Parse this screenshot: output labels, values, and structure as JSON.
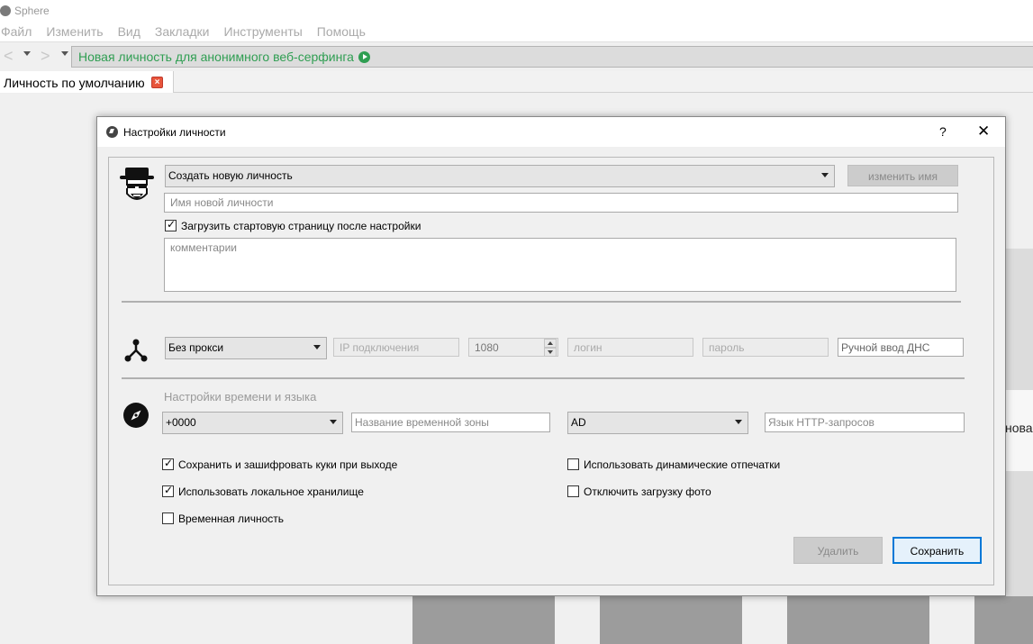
{
  "window": {
    "title": "Sphere"
  },
  "menu": [
    "Файл",
    "Изменить",
    "Вид",
    "Закладки",
    "Инструменты",
    "Помощь"
  ],
  "nav": {
    "back_icon": "arrow-left-icon",
    "forward_icon": "arrow-right-icon",
    "address": "Новая личность для анонимного веб-серфинга",
    "go_icon": "play-circle-icon",
    "accent_color": "#2f9e52"
  },
  "tab": {
    "label": "Личность по умолчанию",
    "close_icon": "close-icon"
  },
  "background": {
    "right_text": "новая"
  },
  "dialog": {
    "title": "Настройки личности",
    "help_label": "?",
    "close_label": "✕",
    "identity": {
      "select_value": "Создать новую личность",
      "rename_button": "изменить имя",
      "name_placeholder": "Имя новой личности",
      "load_start_page_label": "Загрузить стартовую страницу после настройки",
      "load_start_page_checked": true,
      "comments_placeholder": "комментарии"
    },
    "proxy": {
      "type_value": "Без прокси",
      "ip_placeholder": "IP подключения",
      "port_value": "1080",
      "login_placeholder": "логин",
      "password_placeholder": "пароль",
      "dns_placeholder": "Ручной ввод ДНС"
    },
    "time_lang": {
      "section_title": "Настройки времени и языка",
      "offset_value": "+0000",
      "timezone_placeholder": "Название временной зоны",
      "country_value": "AD",
      "http_lang_placeholder": "Язык HTTP-запросов"
    },
    "options": [
      {
        "label": "Сохранить и зашифровать куки при выходе",
        "checked": true
      },
      {
        "label": "Использовать локальное хранилище",
        "checked": true
      },
      {
        "label": "Временная личность",
        "checked": false
      },
      {
        "label": "Использовать динамические отпечатки",
        "checked": false
      },
      {
        "label": "Отключить загрузку фото",
        "checked": false
      }
    ],
    "buttons": {
      "delete": "Удалить",
      "save": "Сохранить"
    },
    "primary_color": "#0078d7"
  }
}
